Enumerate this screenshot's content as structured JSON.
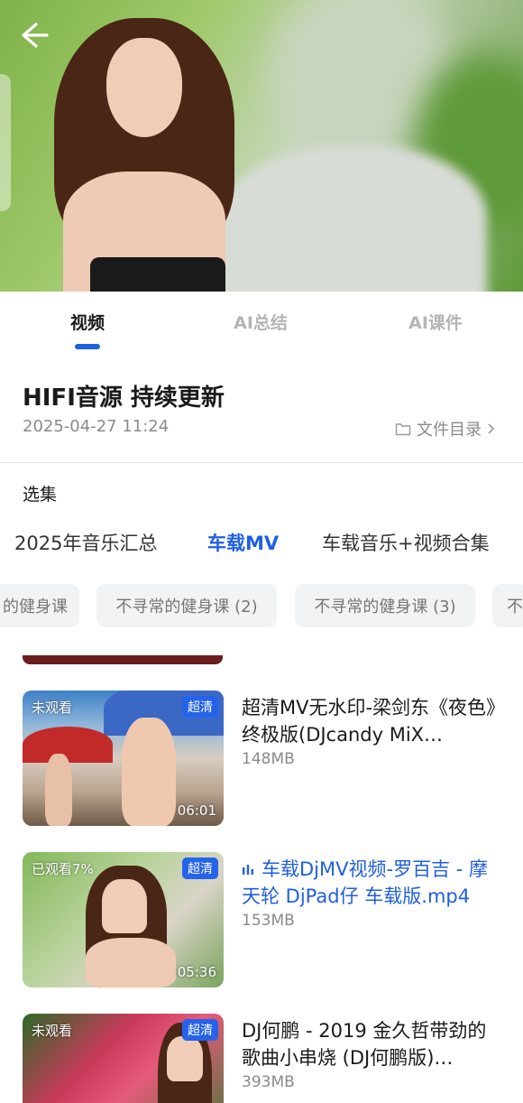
{
  "tabs": [
    {
      "label": "视频",
      "active": true
    },
    {
      "label": "AI总结",
      "active": false
    },
    {
      "label": "AI课件",
      "active": false
    }
  ],
  "video": {
    "title": "HIFI音源 持续更新",
    "date": "2025-04-27 11:24",
    "file_dir_label": "文件目录"
  },
  "episodes": {
    "section_label": "选集",
    "categories": [
      {
        "label": "2025年音乐汇总",
        "active": false
      },
      {
        "label": "车载MV",
        "active": true
      },
      {
        "label": "车载音乐+视频合集",
        "active": false
      }
    ],
    "chips": [
      "的健身课",
      "不寻常的健身课 (2)",
      "不寻常的健身课 (3)",
      "不"
    ]
  },
  "items": [
    {
      "watch_status": "未观看",
      "quality": "超清",
      "duration": "06:01",
      "title": "超清MV无水印-梁剑东《夜色》终极版(DJcandy MiX…",
      "size": "148MB",
      "playing": false
    },
    {
      "watch_status": "已观看7%",
      "quality": "超清",
      "duration": "05:36",
      "title": "车载DjMV视频-罗百吉 - 摩天轮 DjPad仔 车载版.mp4",
      "size": "153MB",
      "playing": true
    },
    {
      "watch_status": "未观看",
      "quality": "超清",
      "duration": "",
      "title": "DJ何鹏 - 2019 金久哲带劲的歌曲小串烧 (DJ何鹏版)…",
      "size": "393MB",
      "playing": false
    }
  ],
  "colors": {
    "accent": "#1f5fe0",
    "hd_badge": "#2563eb"
  }
}
